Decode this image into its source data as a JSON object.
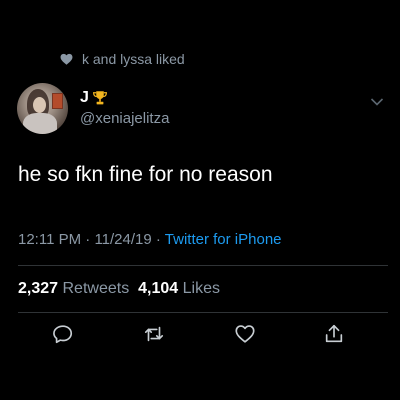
{
  "social_context": {
    "icon": "heart-icon",
    "text": "k and lyssa liked"
  },
  "author": {
    "display_name": "J",
    "name_emoji": "trophy-icon",
    "username": "@xenia​jelitza"
  },
  "tweet": {
    "text": "he so fkn fine for no reason"
  },
  "meta": {
    "time": "12:11 PM",
    "separator1": " · ",
    "date": "11/24/19",
    "separator2": " · ",
    "source": "Twitter for iPhone"
  },
  "stats": {
    "retweets_count": "2,327",
    "retweets_label": "Retweets",
    "likes_count": "4,104",
    "likes_label": "Likes"
  },
  "actions": {
    "reply": "reply-icon",
    "retweet": "retweet-icon",
    "like": "heart-outline-icon",
    "share": "share-icon"
  },
  "colors": {
    "background": "#000000",
    "secondary_text": "#8b98a5",
    "link": "#1d9bf0",
    "divider": "#2f3336"
  }
}
